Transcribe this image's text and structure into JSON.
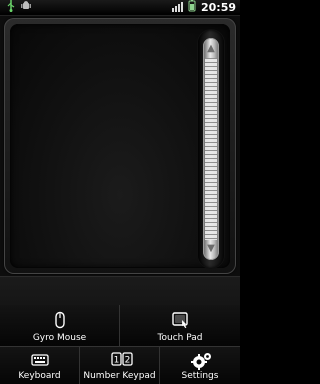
{
  "status_bar": {
    "time": "20:59",
    "icons": [
      "usb-icon",
      "android-icon",
      "signal-icon",
      "battery-icon"
    ]
  },
  "touchpad": {
    "scrollbar_up": "▲",
    "scrollbar_down": "▼"
  },
  "modes": {
    "top": [
      {
        "label": "Gyro Mouse",
        "icon": "mouse-icon"
      },
      {
        "label": "Touch Pad",
        "icon": "touchpad-icon"
      }
    ],
    "bottom": [
      {
        "label": "Keyboard",
        "icon": "keyboard-icon"
      },
      {
        "label": "Number Keypad",
        "icon": "number-keypad-icon"
      },
      {
        "label": "Settings",
        "icon": "settings-icon"
      }
    ]
  },
  "colors": {
    "background": "#0d0d0d",
    "text": "#ffffff"
  }
}
